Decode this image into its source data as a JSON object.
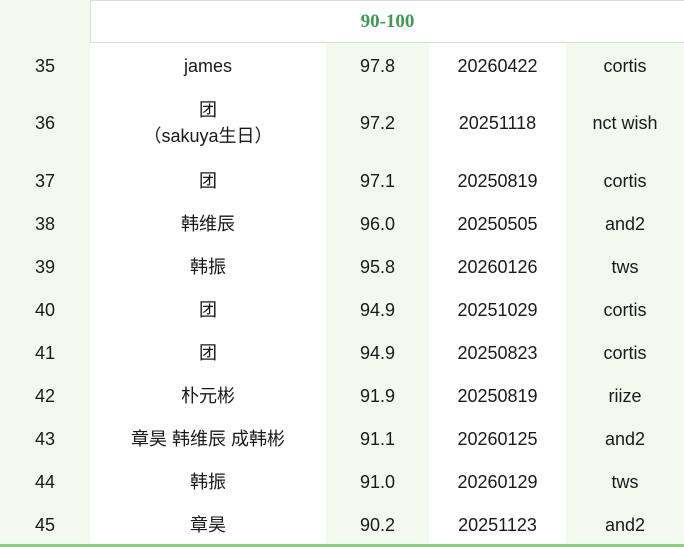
{
  "colors": {
    "header_text": "#3f9a52",
    "band_green": "#f2f9ee",
    "bottom_line": "#8ccf7e"
  },
  "header": {
    "range": "90-100"
  },
  "rows": [
    {
      "rank": "35",
      "name": "james",
      "score": "97.8",
      "date": "20260422",
      "group": "cortis"
    },
    {
      "rank": "36",
      "name": "团\n（sakuya生日）",
      "score": "97.2",
      "date": "20251118",
      "group": "nct wish"
    },
    {
      "rank": "37",
      "name": "团",
      "score": "97.1",
      "date": "20250819",
      "group": "cortis"
    },
    {
      "rank": "38",
      "name": "韩维辰",
      "score": "96.0",
      "date": "20250505",
      "group": "and2"
    },
    {
      "rank": "39",
      "name": "韩振",
      "score": "95.8",
      "date": "20260126",
      "group": "tws"
    },
    {
      "rank": "40",
      "name": "团",
      "score": "94.9",
      "date": "20251029",
      "group": "cortis"
    },
    {
      "rank": "41",
      "name": "团",
      "score": "94.9",
      "date": "20250823",
      "group": "cortis"
    },
    {
      "rank": "42",
      "name": "朴元彬",
      "score": "91.9",
      "date": "20250819",
      "group": "riize"
    },
    {
      "rank": "43",
      "name": "章昊 韩维辰 成韩彬",
      "score": "91.1",
      "date": "20260125",
      "group": "and2"
    },
    {
      "rank": "44",
      "name": "韩振",
      "score": "91.0",
      "date": "20260129",
      "group": "tws"
    },
    {
      "rank": "45",
      "name": "章昊",
      "score": "90.2",
      "date": "20251123",
      "group": "and2"
    }
  ]
}
